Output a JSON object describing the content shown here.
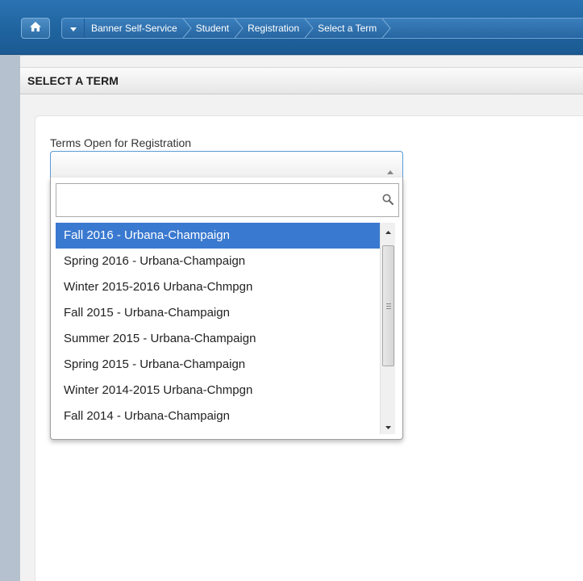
{
  "nav": {
    "home_icon": "home-icon",
    "toggle_icon": "caret-down-icon",
    "breadcrumbs": [
      "Banner Self-Service",
      "Student",
      "Registration",
      "Select a Term"
    ]
  },
  "page": {
    "title": "SELECT A TERM"
  },
  "term_select": {
    "label": "Terms Open for Registration",
    "selected_value": "",
    "search_placeholder": "",
    "search_icon": "magnifier-icon",
    "options": [
      "Fall 2016 - Urbana-Champaign",
      "Spring 2016 - Urbana-Champaign",
      "Winter 2015-2016 Urbana-Chmpgn",
      "Fall 2015 - Urbana-Champaign",
      "Summer 2015 - Urbana-Champaign",
      "Spring 2015 - Urbana-Champaign",
      "Winter 2014-2015 Urbana-Chmpgn",
      "Fall 2014 - Urbana-Champaign"
    ],
    "highlighted_option": "Fall 2016 - Urbana-Champaign"
  },
  "colors": {
    "nav_bar": "#1f649f",
    "highlight": "#3a79d0",
    "select_border": "#5a9ad4"
  }
}
